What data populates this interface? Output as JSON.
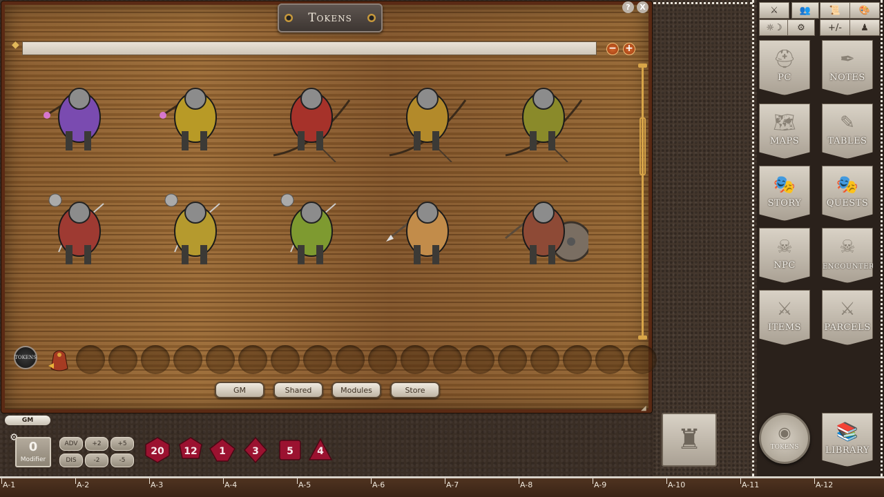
{
  "window": {
    "title": "Tokens",
    "help_label": "?",
    "close_label": "X"
  },
  "zoom": {
    "minus": "−",
    "plus": "+"
  },
  "tabs": [
    {
      "label": "GM"
    },
    {
      "label": "Shared"
    },
    {
      "label": "Modules"
    },
    {
      "label": "Store"
    }
  ],
  "tray": {
    "badge": "TOKENS"
  },
  "toolbar_icons": [
    "combat-icon",
    "party-icon",
    "scroll-icon",
    "palette-icon",
    "daynight-icon",
    "gear-icon",
    "modifier-icon",
    "figure-icon"
  ],
  "toolbar_glyphs": [
    "⚔",
    "👥",
    "📜",
    "🎨",
    "☼☽",
    "⚙",
    "+/-",
    "♟"
  ],
  "sidebar": {
    "items": [
      {
        "label": "PC",
        "glyph": "⛑"
      },
      {
        "label": "NOTES",
        "glyph": "✒"
      },
      {
        "label": "MAPS",
        "glyph": "🗺"
      },
      {
        "label": "TABLES",
        "glyph": "✎"
      },
      {
        "label": "STORY",
        "glyph": "🎭"
      },
      {
        "label": "QUESTS",
        "glyph": "🎭"
      },
      {
        "label": "NPC",
        "glyph": "☠"
      },
      {
        "label": "ENCOUNTERS",
        "glyph": "☠"
      },
      {
        "label": "ITEMS",
        "glyph": "⚔"
      },
      {
        "label": "PARCELS",
        "glyph": "⚔"
      }
    ],
    "tokens_label": "TOKENS",
    "library_label": "LIBRARY"
  },
  "bottom": {
    "gm_label": "GM",
    "modifier_value": "0",
    "modifier_caption": "Modifier",
    "buttons": [
      "ADV",
      "+2",
      "+5",
      "DIS",
      "-2",
      "-5"
    ]
  },
  "dice": [
    {
      "name": "d20",
      "label": "20",
      "color": "#9b1230"
    },
    {
      "name": "d12",
      "label": "12",
      "color": "#9b1230"
    },
    {
      "name": "d10",
      "label": "1",
      "color": "#9b1230"
    },
    {
      "name": "d8",
      "label": "3",
      "color": "#9b1230"
    },
    {
      "name": "d6",
      "label": "5",
      "color": "#9b1230"
    },
    {
      "name": "d4",
      "label": "4",
      "color": "#9b1230"
    }
  ],
  "ruler": [
    "A-1",
    "A-2",
    "A-3",
    "A-4",
    "A-5",
    "A-6",
    "A-7",
    "A-8",
    "A-9",
    "A-10",
    "A-11",
    "A-12"
  ],
  "tokens": [
    {
      "row": 0,
      "kind": "mage",
      "cloak": "#7a4bb0"
    },
    {
      "row": 0,
      "kind": "mage",
      "cloak": "#b89a26"
    },
    {
      "row": 0,
      "kind": "archer",
      "cloak": "#a6322a"
    },
    {
      "row": 0,
      "kind": "archer",
      "cloak": "#b38a2a"
    },
    {
      "row": 0,
      "kind": "archer",
      "cloak": "#8a8a2a"
    },
    {
      "row": 1,
      "kind": "swords",
      "cloak": "#9e3a32"
    },
    {
      "row": 1,
      "kind": "swords",
      "cloak": "#b59a2e"
    },
    {
      "row": 1,
      "kind": "swords",
      "cloak": "#7e9a30"
    },
    {
      "row": 1,
      "kind": "spear",
      "cloak": "#c28c4a"
    },
    {
      "row": 1,
      "kind": "shield",
      "cloak": "#8e4a36"
    },
    {
      "row": 2,
      "kind": "head",
      "cloak": "#3e4f82"
    },
    {
      "row": 2,
      "kind": "head",
      "cloak": "#9a9388"
    },
    {
      "row": 2,
      "kind": "head",
      "cloak": "#a89a72"
    },
    {
      "row": 2,
      "kind": "head",
      "cloak": "#3f6a3a"
    },
    {
      "row": 2,
      "kind": "head",
      "cloak": "#8e3a32"
    }
  ]
}
